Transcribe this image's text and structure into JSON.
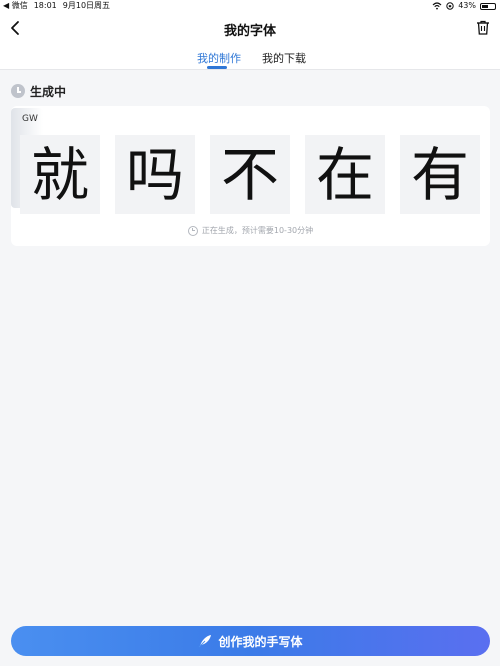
{
  "status_bar": {
    "app": "◀ 微信",
    "time": "18:01",
    "date": "9月10日周五",
    "battery": "43%"
  },
  "nav": {
    "title": "我的字体"
  },
  "tabs": [
    {
      "label": "我的制作",
      "active": true
    },
    {
      "label": "我的下载",
      "active": false
    }
  ],
  "section": {
    "title": "生成中"
  },
  "card": {
    "label": "GW",
    "glyphs": [
      "就",
      "吗",
      "不",
      "在",
      "有"
    ],
    "note": "正在生成，预计需要10-30分钟"
  },
  "bottom": {
    "create_label": "创作我的手写体"
  },
  "colors": {
    "accent": "#2f77d6",
    "button_gradient_start": "#4a8ff0",
    "button_gradient_end": "#5a6ff0",
    "background": "#f5f6f8"
  }
}
